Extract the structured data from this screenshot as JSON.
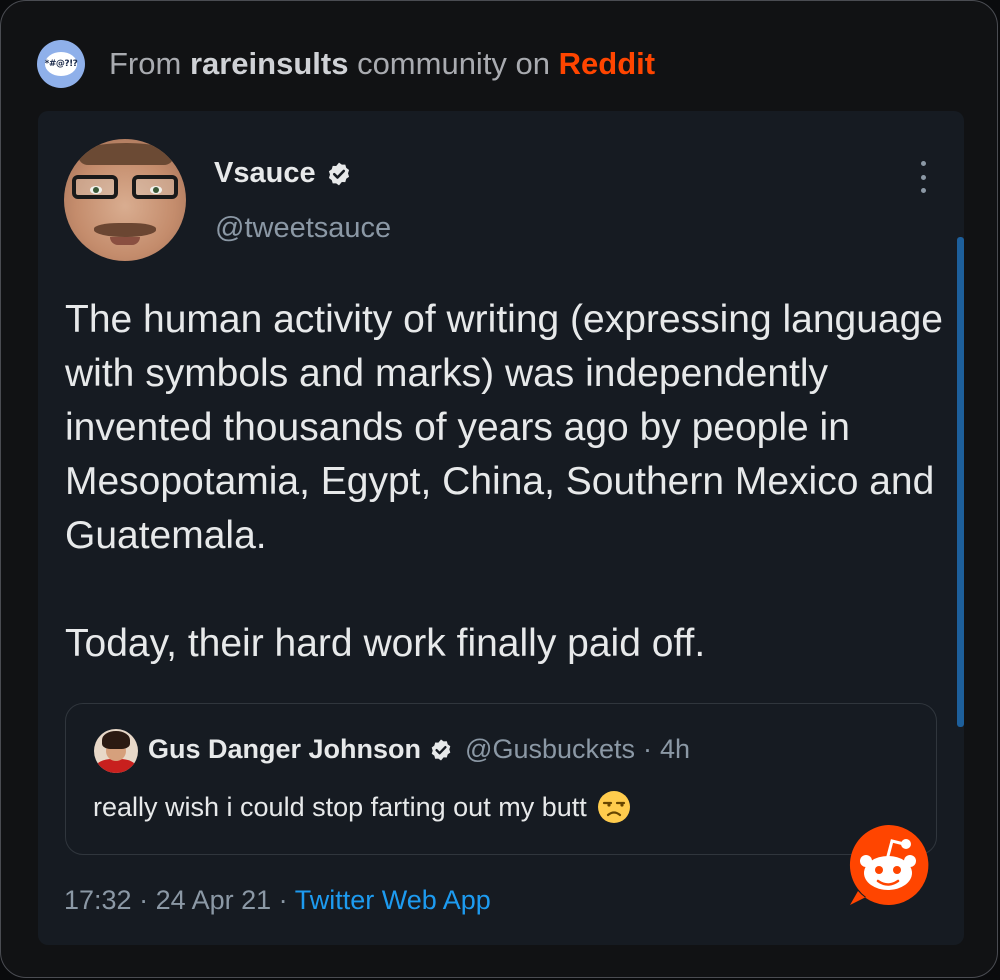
{
  "source": {
    "prefix": "From ",
    "community": "rareinsults",
    "middle": " community on ",
    "platform": "Reddit",
    "icon": "speech-bubble-icon",
    "icon_glyph": "*#@?!?"
  },
  "tweet": {
    "display_name": "Vsauce",
    "handle": "@tweetsauce",
    "verified": true,
    "paragraphs": [
      "The human activity of writing (expressing language with symbols and marks) was independently invented thousands of years ago by people in Mesopotamia, Egypt, China, Southern Mexico and Guatemala.",
      "Today, their hard work finally paid off."
    ],
    "time": "17:32",
    "sep1": " · ",
    "date": "24 Apr 21",
    "sep2": " · ",
    "app": "Twitter Web App"
  },
  "quoted": {
    "display_name": "Gus Danger Johnson",
    "verified": true,
    "handle": "@Gusbuckets",
    "dot": "·",
    "age": "4h",
    "text": "really wish i could stop farting out my butt",
    "emoji": "unamused-face-icon"
  },
  "colors": {
    "reddit_orange": "#ff4500",
    "twitter_blue": "#1d9bf0",
    "card_bg": "#161b22",
    "text_primary": "#e7e9ea",
    "text_secondary": "#8b98a5"
  }
}
